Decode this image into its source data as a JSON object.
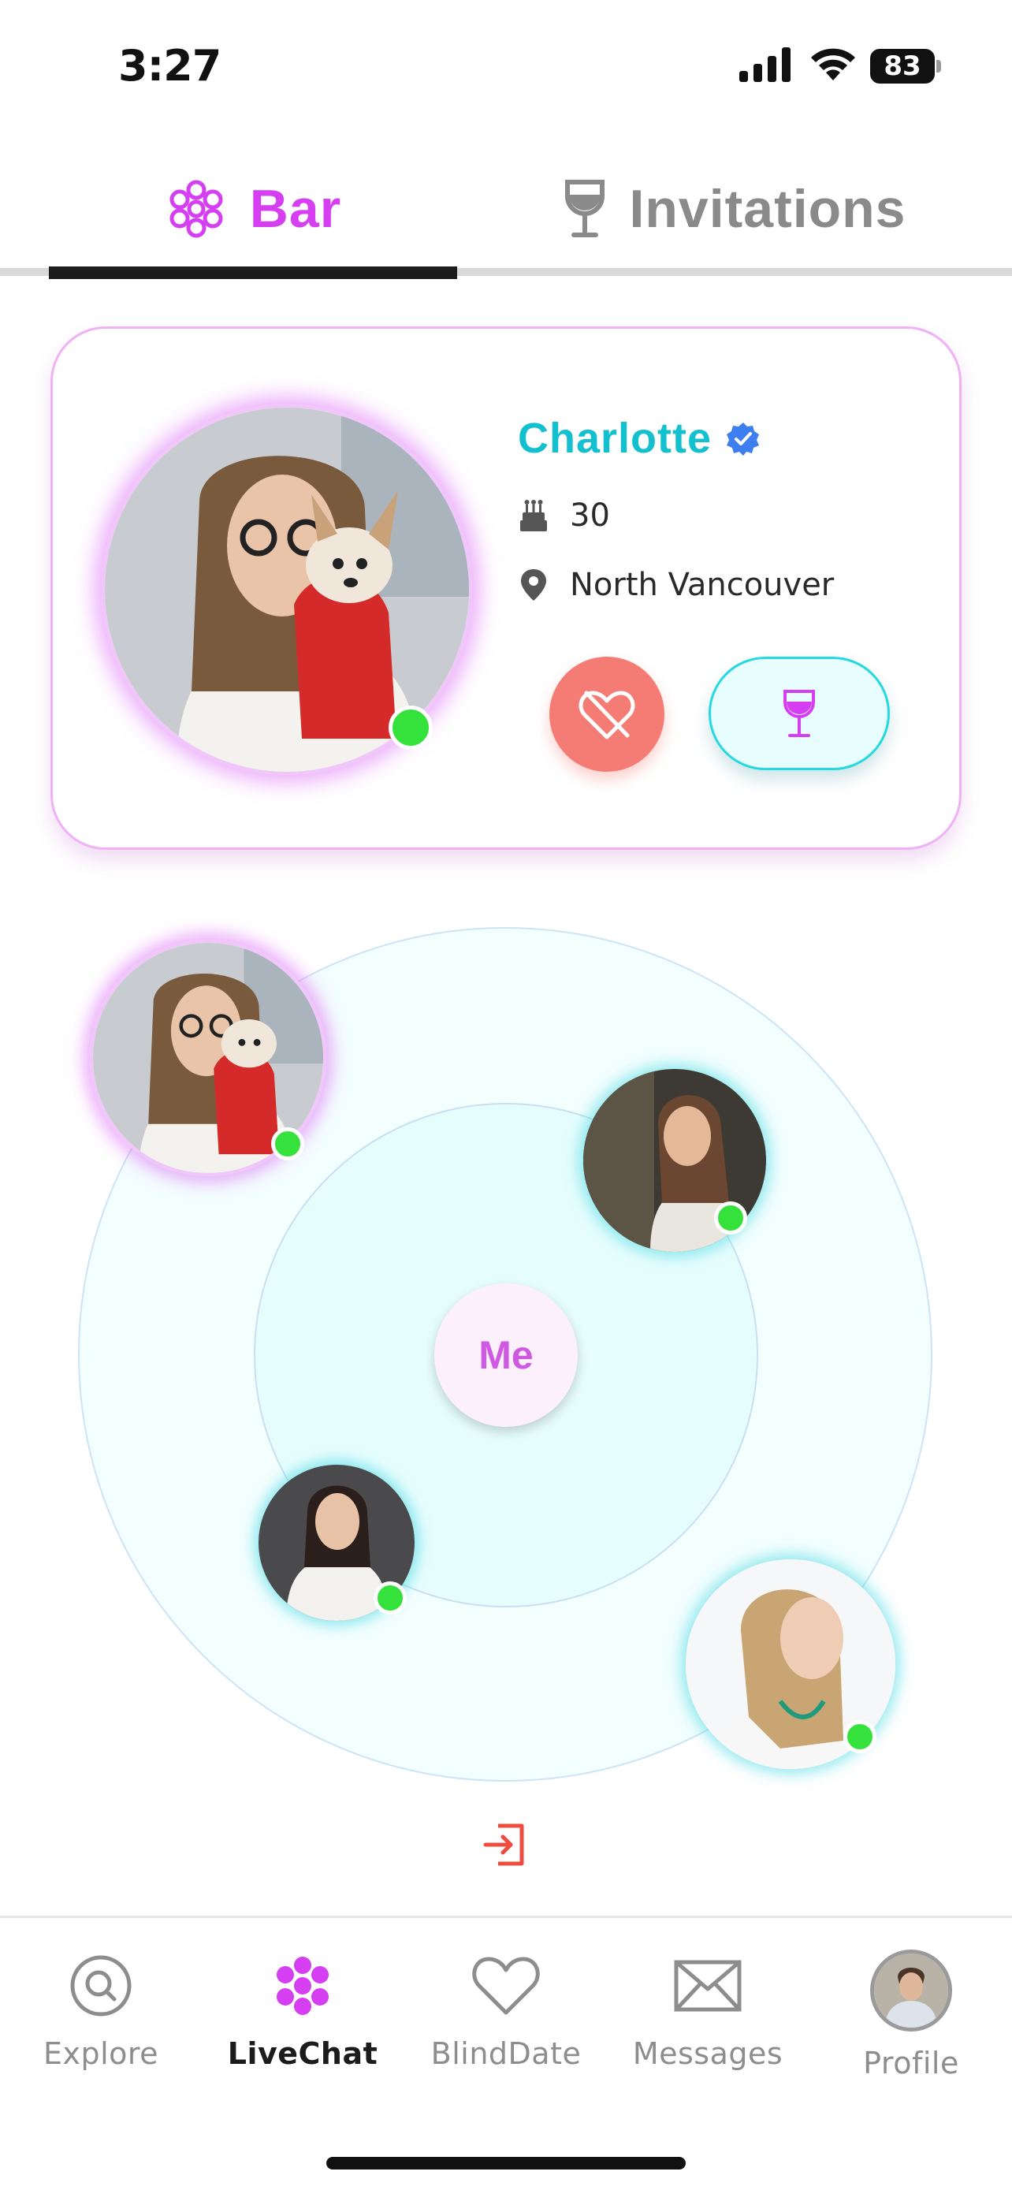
{
  "status_bar": {
    "time": "3:27",
    "battery": "83"
  },
  "tabs": [
    {
      "label": "Bar",
      "active": true
    },
    {
      "label": "Invitations",
      "active": false
    }
  ],
  "profile_card": {
    "name": "Charlotte",
    "age": "30",
    "location": "North Vancouver",
    "online": true,
    "verified": true
  },
  "radar": {
    "center_label": "Me",
    "users": [
      {
        "name": "Charlotte",
        "online": true
      },
      {
        "online": true
      },
      {
        "online": true
      },
      {
        "online": true
      }
    ]
  },
  "bottom_nav": {
    "items": [
      {
        "label": "Explore",
        "icon": "search-icon",
        "active": false
      },
      {
        "label": "LiveChat",
        "icon": "dots-cluster-icon",
        "active": true
      },
      {
        "label": "BlindDate",
        "icon": "heart-icon",
        "active": false
      },
      {
        "label": "Messages",
        "icon": "envelope-icon",
        "active": false
      },
      {
        "label": "Profile",
        "icon": "avatar",
        "active": false
      }
    ]
  },
  "colors": {
    "accent_magenta": "#d63ef2",
    "accent_teal": "#13c0cf",
    "online_green": "#35e13b",
    "dislike_red": "#f47c74"
  }
}
